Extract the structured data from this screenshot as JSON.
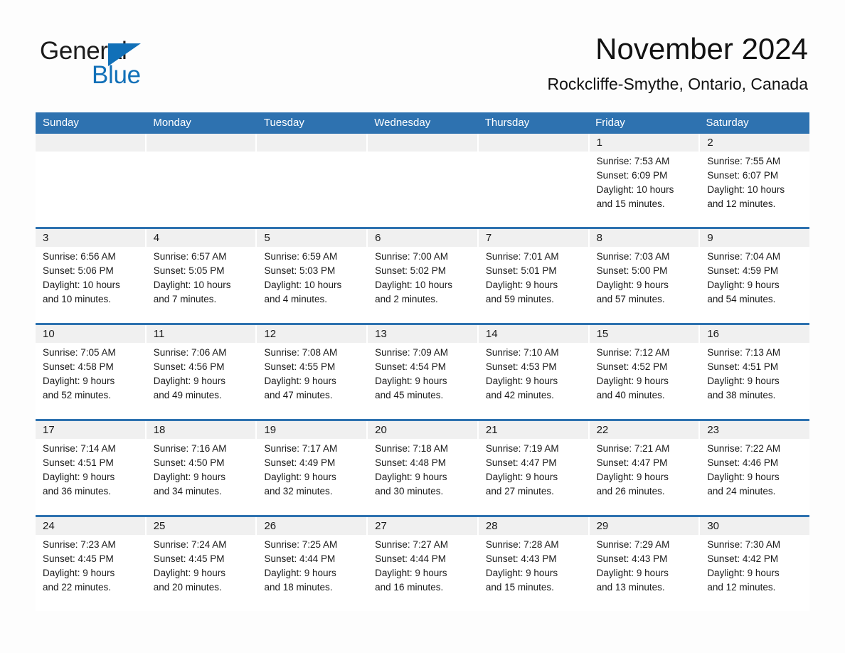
{
  "brand": {
    "name_part1": "General",
    "name_part2": "Blue",
    "triangle_icon": "brand-triangle-icon",
    "accent_color": "#1170b8"
  },
  "header": {
    "title": "November 2024",
    "location": "Rockcliffe-Smythe, Ontario, Canada"
  },
  "theme": {
    "header_blue": "#2e72b0",
    "day_band_gray": "#f0f0f0",
    "page_background": "#ffffff"
  },
  "weekdays": [
    "Sunday",
    "Monday",
    "Tuesday",
    "Wednesday",
    "Thursday",
    "Friday",
    "Saturday"
  ],
  "weeks": [
    [
      {
        "day": "",
        "lines": []
      },
      {
        "day": "",
        "lines": []
      },
      {
        "day": "",
        "lines": []
      },
      {
        "day": "",
        "lines": []
      },
      {
        "day": "",
        "lines": []
      },
      {
        "day": "1",
        "lines": [
          "Sunrise: 7:53 AM",
          "Sunset: 6:09 PM",
          "Daylight: 10 hours",
          "and 15 minutes."
        ]
      },
      {
        "day": "2",
        "lines": [
          "Sunrise: 7:55 AM",
          "Sunset: 6:07 PM",
          "Daylight: 10 hours",
          "and 12 minutes."
        ]
      }
    ],
    [
      {
        "day": "3",
        "lines": [
          "Sunrise: 6:56 AM",
          "Sunset: 5:06 PM",
          "Daylight: 10 hours",
          "and 10 minutes."
        ]
      },
      {
        "day": "4",
        "lines": [
          "Sunrise: 6:57 AM",
          "Sunset: 5:05 PM",
          "Daylight: 10 hours",
          "and 7 minutes."
        ]
      },
      {
        "day": "5",
        "lines": [
          "Sunrise: 6:59 AM",
          "Sunset: 5:03 PM",
          "Daylight: 10 hours",
          "and 4 minutes."
        ]
      },
      {
        "day": "6",
        "lines": [
          "Sunrise: 7:00 AM",
          "Sunset: 5:02 PM",
          "Daylight: 10 hours",
          "and 2 minutes."
        ]
      },
      {
        "day": "7",
        "lines": [
          "Sunrise: 7:01 AM",
          "Sunset: 5:01 PM",
          "Daylight: 9 hours",
          "and 59 minutes."
        ]
      },
      {
        "day": "8",
        "lines": [
          "Sunrise: 7:03 AM",
          "Sunset: 5:00 PM",
          "Daylight: 9 hours",
          "and 57 minutes."
        ]
      },
      {
        "day": "9",
        "lines": [
          "Sunrise: 7:04 AM",
          "Sunset: 4:59 PM",
          "Daylight: 9 hours",
          "and 54 minutes."
        ]
      }
    ],
    [
      {
        "day": "10",
        "lines": [
          "Sunrise: 7:05 AM",
          "Sunset: 4:58 PM",
          "Daylight: 9 hours",
          "and 52 minutes."
        ]
      },
      {
        "day": "11",
        "lines": [
          "Sunrise: 7:06 AM",
          "Sunset: 4:56 PM",
          "Daylight: 9 hours",
          "and 49 minutes."
        ]
      },
      {
        "day": "12",
        "lines": [
          "Sunrise: 7:08 AM",
          "Sunset: 4:55 PM",
          "Daylight: 9 hours",
          "and 47 minutes."
        ]
      },
      {
        "day": "13",
        "lines": [
          "Sunrise: 7:09 AM",
          "Sunset: 4:54 PM",
          "Daylight: 9 hours",
          "and 45 minutes."
        ]
      },
      {
        "day": "14",
        "lines": [
          "Sunrise: 7:10 AM",
          "Sunset: 4:53 PM",
          "Daylight: 9 hours",
          "and 42 minutes."
        ]
      },
      {
        "day": "15",
        "lines": [
          "Sunrise: 7:12 AM",
          "Sunset: 4:52 PM",
          "Daylight: 9 hours",
          "and 40 minutes."
        ]
      },
      {
        "day": "16",
        "lines": [
          "Sunrise: 7:13 AM",
          "Sunset: 4:51 PM",
          "Daylight: 9 hours",
          "and 38 minutes."
        ]
      }
    ],
    [
      {
        "day": "17",
        "lines": [
          "Sunrise: 7:14 AM",
          "Sunset: 4:51 PM",
          "Daylight: 9 hours",
          "and 36 minutes."
        ]
      },
      {
        "day": "18",
        "lines": [
          "Sunrise: 7:16 AM",
          "Sunset: 4:50 PM",
          "Daylight: 9 hours",
          "and 34 minutes."
        ]
      },
      {
        "day": "19",
        "lines": [
          "Sunrise: 7:17 AM",
          "Sunset: 4:49 PM",
          "Daylight: 9 hours",
          "and 32 minutes."
        ]
      },
      {
        "day": "20",
        "lines": [
          "Sunrise: 7:18 AM",
          "Sunset: 4:48 PM",
          "Daylight: 9 hours",
          "and 30 minutes."
        ]
      },
      {
        "day": "21",
        "lines": [
          "Sunrise: 7:19 AM",
          "Sunset: 4:47 PM",
          "Daylight: 9 hours",
          "and 27 minutes."
        ]
      },
      {
        "day": "22",
        "lines": [
          "Sunrise: 7:21 AM",
          "Sunset: 4:47 PM",
          "Daylight: 9 hours",
          "and 26 minutes."
        ]
      },
      {
        "day": "23",
        "lines": [
          "Sunrise: 7:22 AM",
          "Sunset: 4:46 PM",
          "Daylight: 9 hours",
          "and 24 minutes."
        ]
      }
    ],
    [
      {
        "day": "24",
        "lines": [
          "Sunrise: 7:23 AM",
          "Sunset: 4:45 PM",
          "Daylight: 9 hours",
          "and 22 minutes."
        ]
      },
      {
        "day": "25",
        "lines": [
          "Sunrise: 7:24 AM",
          "Sunset: 4:45 PM",
          "Daylight: 9 hours",
          "and 20 minutes."
        ]
      },
      {
        "day": "26",
        "lines": [
          "Sunrise: 7:25 AM",
          "Sunset: 4:44 PM",
          "Daylight: 9 hours",
          "and 18 minutes."
        ]
      },
      {
        "day": "27",
        "lines": [
          "Sunrise: 7:27 AM",
          "Sunset: 4:44 PM",
          "Daylight: 9 hours",
          "and 16 minutes."
        ]
      },
      {
        "day": "28",
        "lines": [
          "Sunrise: 7:28 AM",
          "Sunset: 4:43 PM",
          "Daylight: 9 hours",
          "and 15 minutes."
        ]
      },
      {
        "day": "29",
        "lines": [
          "Sunrise: 7:29 AM",
          "Sunset: 4:43 PM",
          "Daylight: 9 hours",
          "and 13 minutes."
        ]
      },
      {
        "day": "30",
        "lines": [
          "Sunrise: 7:30 AM",
          "Sunset: 4:42 PM",
          "Daylight: 9 hours",
          "and 12 minutes."
        ]
      }
    ]
  ]
}
